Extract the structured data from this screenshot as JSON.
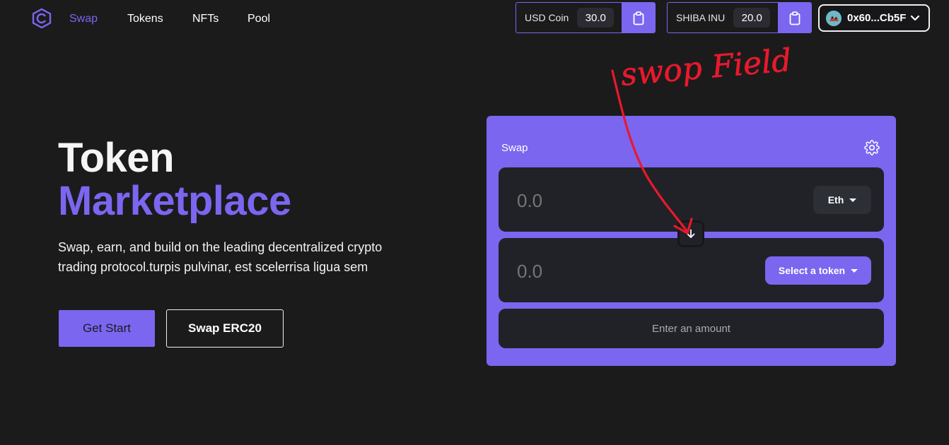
{
  "nav": {
    "links": [
      "Swap",
      "Tokens",
      "NFTs",
      "Pool"
    ],
    "active": "Swap"
  },
  "balances": [
    {
      "label": "USD Coin",
      "value": "30.0"
    },
    {
      "label": "SHIBA INU",
      "value": "20.0"
    }
  ],
  "account": {
    "address": "0x60...Cb5F"
  },
  "hero": {
    "title_line1": "Token",
    "title_line2": "Marketplace",
    "description": "Swap, earn, and build on the leading decentralized crypto trading protocol.turpis pulvinar, est scelerrisa ligua sem",
    "primary_button": "Get Start",
    "secondary_button": "Swap ERC20"
  },
  "swap": {
    "title": "Swap",
    "from_amount_placeholder": "0.0",
    "from_token": "Eth",
    "to_amount_placeholder": "0.0",
    "to_token": "Select a token",
    "submit_label": "Enter an amount"
  },
  "annotation": {
    "text": "swop Field"
  },
  "colors": {
    "background": "#1b1b1c",
    "accent": "#7b66f0",
    "panel": "#212228",
    "annotation": "#e8192c"
  },
  "icons": {
    "logo": "c-hexagon-logo-icon",
    "copy": "clipboard-icon",
    "settings": "gear-icon",
    "switch": "arrow-down-icon",
    "account_menu": "chevron-down-icon"
  }
}
